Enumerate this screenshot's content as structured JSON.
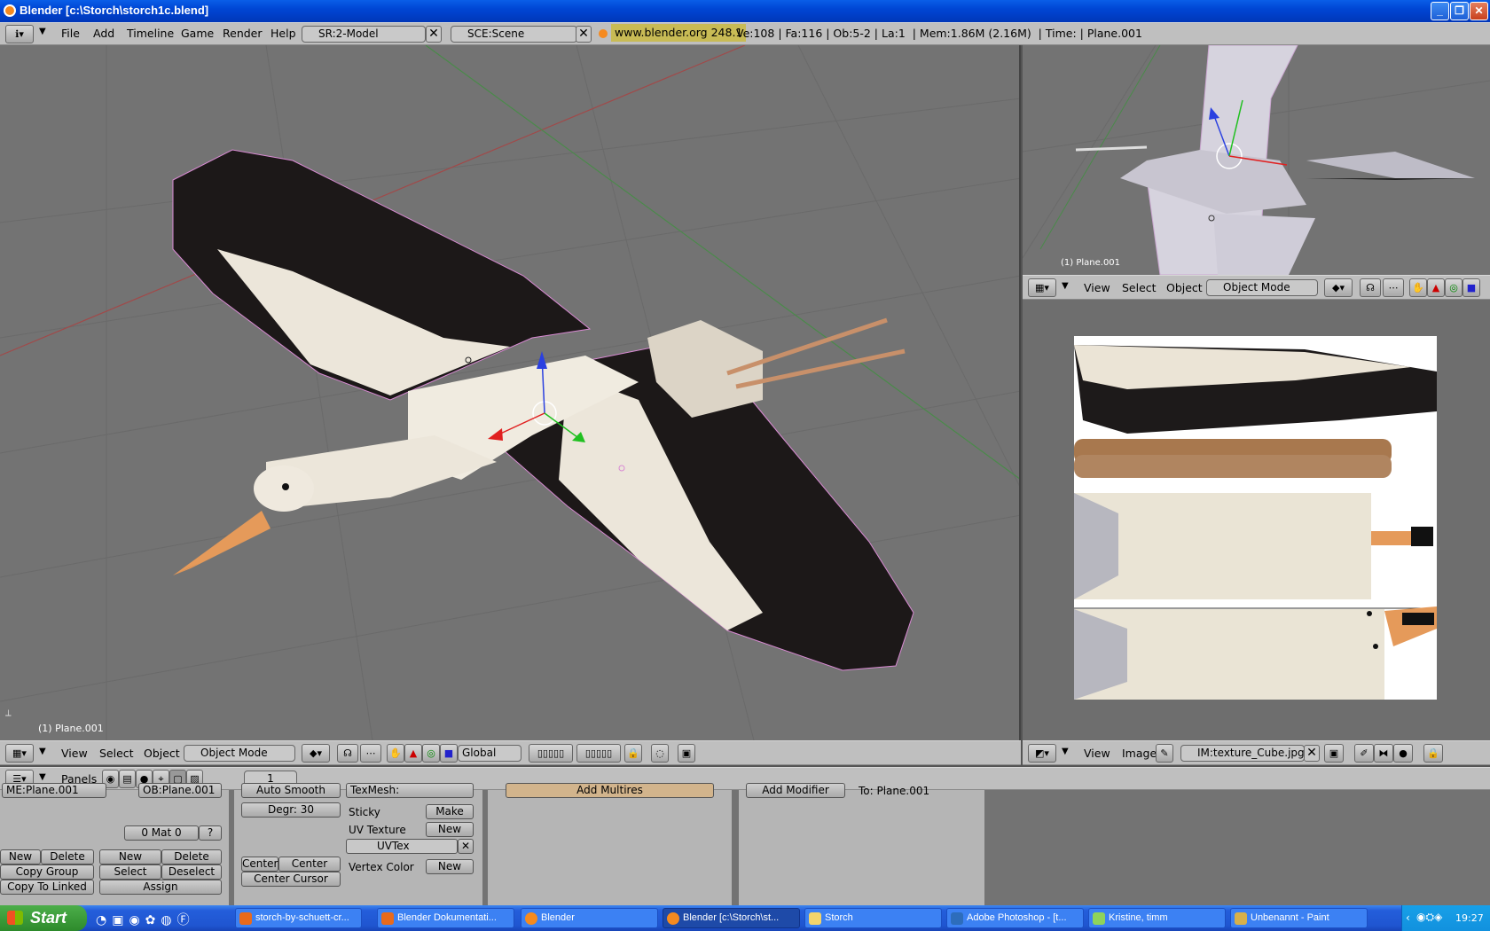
{
  "window": {
    "title": "Blender [c:\\Storch\\storch1c.blend]"
  },
  "top_header": {
    "menus": [
      "File",
      "Add",
      "Timeline",
      "Game",
      "Render",
      "Help"
    ],
    "screen": "SR:2-Model",
    "scene": "SCE:Scene",
    "url": "www.blender.org 248.1",
    "stats": "Ve:108 | Fa:116 | Ob:5-2 | La:1  | Mem:1.86M (2.16M)  | Time: | Plane.001"
  },
  "main_viewport": {
    "object_label": "(1) Plane.001",
    "menus": [
      "View",
      "Select",
      "Object"
    ],
    "mode": "Object Mode",
    "orientation": "Global"
  },
  "small_viewport": {
    "object_label": "(1) Plane.001",
    "menus": [
      "View",
      "Select",
      "Object"
    ],
    "mode": "Object Mode"
  },
  "image_editor": {
    "menus": [
      "View",
      "Image"
    ],
    "image_name": "IM:texture_Cube.jpg"
  },
  "buttons": {
    "panels_label": "Panels",
    "frame": "1",
    "link": {
      "me_field": "ME:Plane.001",
      "ob_field": "OB:Plane.001",
      "mat": "0 Mat 0",
      "help": "?"
    },
    "vgroup": [
      "New",
      "Delete",
      "Copy Group",
      "Copy To Linked"
    ],
    "material": [
      "New",
      "Delete",
      "Select",
      "Deselect",
      "Assign"
    ],
    "auto_smooth": "Auto Smooth",
    "degr": "Degr: 30",
    "center": [
      "Center",
      "Center New",
      "Center Cursor"
    ],
    "texface": "TexMesh:",
    "sticky": "Sticky",
    "make": "Make",
    "uv_texture": "UV Texture",
    "uv_new": "New",
    "uvtex": "UVTex",
    "vertex_color": "Vertex Color",
    "vc_new": "New",
    "add_multires": "Add Multires",
    "add_modifier": "Add Modifier",
    "to_label": "To: Plane.001"
  },
  "taskbar": {
    "start": "Start",
    "tasks": [
      "storch-by-schuett-cr...",
      "Blender Dokumentati...",
      "Blender",
      "Blender [c:\\Storch\\st...",
      "Storch",
      "Adobe Photoshop - [t...",
      "Kristine, timm",
      "Unbenannt - Paint"
    ],
    "time": "19:27"
  }
}
